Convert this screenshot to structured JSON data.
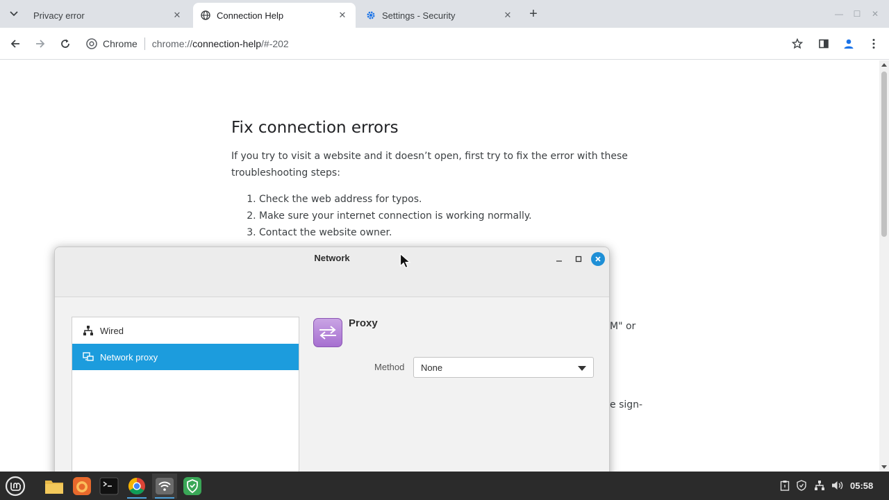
{
  "browser": {
    "tabs": [
      {
        "title": "Privacy error",
        "active": false
      },
      {
        "title": "Connection Help",
        "active": true
      },
      {
        "title": "Settings - Security",
        "active": false
      }
    ],
    "omnibox": {
      "chip_label": "Chrome",
      "url_scheme": "chrome://",
      "url_host": "connection-help",
      "url_path": "/#-202"
    }
  },
  "page": {
    "heading": "Fix connection errors",
    "intro": "If you try to visit a website and it doesn’t open, first try to fix the error with these troubleshooting steps:",
    "steps": [
      "Check the web address for typos.",
      "Make sure your internet connection is working normally.",
      "Contact the website owner."
    ],
    "fragment_1": "M\" or",
    "fragment_2": "e sign-"
  },
  "dialog": {
    "title": "Network",
    "sidebar": [
      {
        "label": "Wired",
        "icon": "wired-network-icon",
        "selected": false
      },
      {
        "label": "Network proxy",
        "icon": "network-proxy-icon",
        "selected": true
      }
    ],
    "panel": {
      "title": "Proxy",
      "method_label": "Method",
      "method_value": "None"
    }
  },
  "taskbar": {
    "clock": "05:58",
    "accent_color": "#4ea3dc"
  },
  "colors": {
    "selection": "#1c9cdd",
    "close_button": "#1e8fd6",
    "settings_tab_icon": "#1a73e8"
  }
}
